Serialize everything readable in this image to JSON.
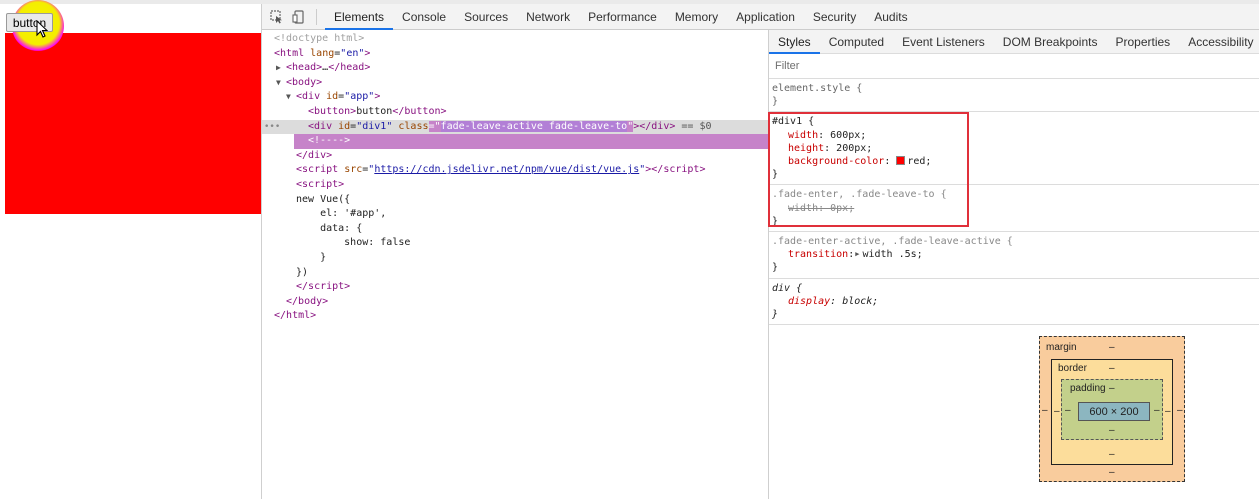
{
  "page": {
    "button_label": "button",
    "div_color": "#ff0000",
    "cursor_highlight_color": "#f4ee00"
  },
  "toolbar": {
    "icons": [
      "inspect-element-icon",
      "device-toolbar-icon"
    ],
    "tabs": [
      {
        "label": "Elements",
        "active": true
      },
      {
        "label": "Console"
      },
      {
        "label": "Sources"
      },
      {
        "label": "Network"
      },
      {
        "label": "Performance"
      },
      {
        "label": "Memory"
      },
      {
        "label": "Application"
      },
      {
        "label": "Security"
      },
      {
        "label": "Audits"
      }
    ],
    "accent": "#1a73e8"
  },
  "elements": {
    "doctype": "<!doctype html>",
    "html_open_tag": "html",
    "html_lang_attr": "lang",
    "html_lang_val": "en",
    "head_tag": "head",
    "head_ellipsis": "…",
    "body_tag": "body",
    "div_app_tag": "div",
    "div_app_id_attr": "id",
    "div_app_id_val": "app",
    "button_tag": "button",
    "button_text": "button",
    "div1_tag": "div",
    "div1_id_attr": "id",
    "div1_id_val": "div1",
    "div1_class_attr": "class",
    "div1_class_val": "fade-leave-active fade-leave-to",
    "selected_marker": " == $0",
    "comment": "<!---->",
    "div_close": "div",
    "script_tag": "script",
    "script_src_attr": "src",
    "script_src_val": "https://cdn.jsdelivr.net/npm/vue/dist/vue.js",
    "js_line1": "new Vue({",
    "js_line2": "    el: '#app',",
    "js_line3": "    data: {",
    "js_line4": "        show: false",
    "js_line5": "    }",
    "js_line6": "})",
    "script_close": "script",
    "body_close": "body",
    "html_close": "html"
  },
  "styles": {
    "sub_tabs": [
      {
        "label": "Styles",
        "active": true
      },
      {
        "label": "Computed"
      },
      {
        "label": "Event Listeners"
      },
      {
        "label": "DOM Breakpoints"
      },
      {
        "label": "Properties"
      },
      {
        "label": "Accessibility"
      }
    ],
    "filter_placeholder": "Filter",
    "rules": {
      "element_style": {
        "selector": "element.style {",
        "close": "}"
      },
      "div1": {
        "selector": "#div1 {",
        "width_name": "width",
        "width_val": "600px;",
        "height_name": "height",
        "height_val": "200px;",
        "bg_name": "background-color",
        "bg_val": "red;",
        "close": "}"
      },
      "fade_enter": {
        "selector": ".fade-enter, .fade-leave-to {",
        "width_text": "width: 0px;",
        "close": "}"
      },
      "fade_active": {
        "selector": ".fade-enter-active, .fade-leave-active {",
        "transition_name": "transition",
        "transition_val": "width .5s;",
        "close": "}"
      },
      "div_ua": {
        "selector": "div {",
        "display_name": "display",
        "display_val": "block;",
        "close": "}"
      }
    },
    "annotation_color": "#e0303a"
  },
  "box_model": {
    "margin_label": "margin",
    "border_label": "border",
    "padding_label": "padding",
    "content": "600 × 200",
    "dash": "–",
    "colors": {
      "margin": "#f9cc9d",
      "border": "#fcdd9b",
      "padding": "#c3d08b",
      "content": "#8cb6c0"
    }
  }
}
